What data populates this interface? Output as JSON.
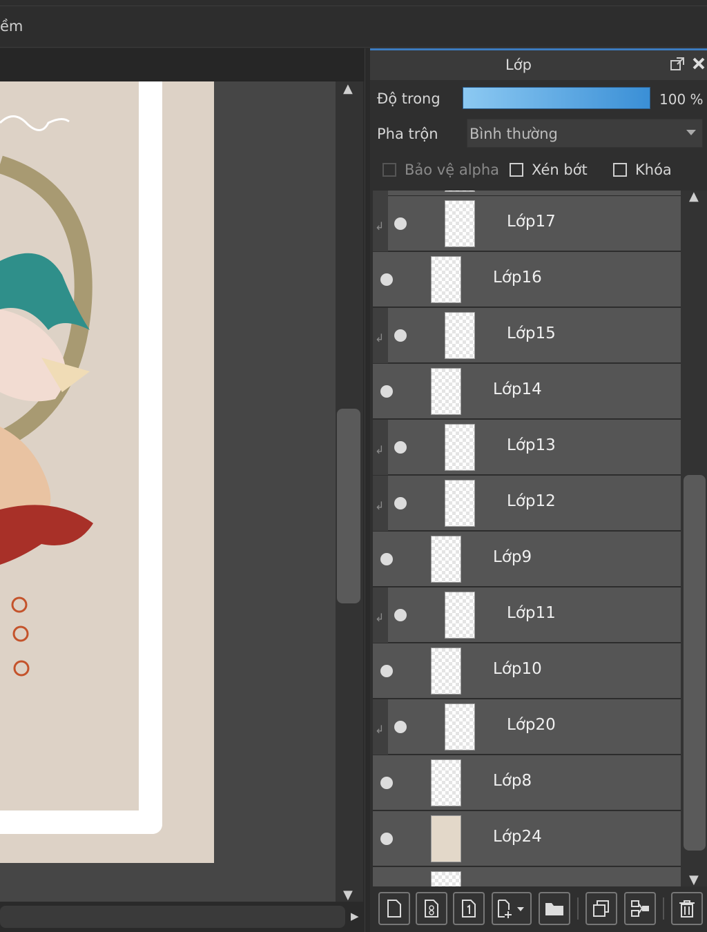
{
  "menubar": {
    "partial_label": "ềm"
  },
  "panel": {
    "title": "Lớp",
    "opacity": {
      "label": "Độ trong",
      "value_text": "100 %",
      "value_percent": 100
    },
    "blend": {
      "label": "Pha trộn",
      "selected": "Bình thường"
    },
    "options": {
      "protect_alpha": "Bảo vệ alpha",
      "clipping": "Xén bớt",
      "lock": "Khóa"
    },
    "layers": [
      {
        "name": "Lớp17",
        "clipped": true
      },
      {
        "name": "Lớp16",
        "clipped": false
      },
      {
        "name": "Lớp15",
        "clipped": true
      },
      {
        "name": "Lớp14",
        "clipped": false
      },
      {
        "name": "Lớp13",
        "clipped": true
      },
      {
        "name": "Lớp12",
        "clipped": true
      },
      {
        "name": "Lớp9",
        "clipped": false
      },
      {
        "name": "Lớp11",
        "clipped": true
      },
      {
        "name": "Lớp10",
        "clipped": false
      },
      {
        "name": "Lớp20",
        "clipped": true
      },
      {
        "name": "Lớp8",
        "clipped": false
      },
      {
        "name": "Lớp24",
        "clipped": false
      }
    ]
  }
}
